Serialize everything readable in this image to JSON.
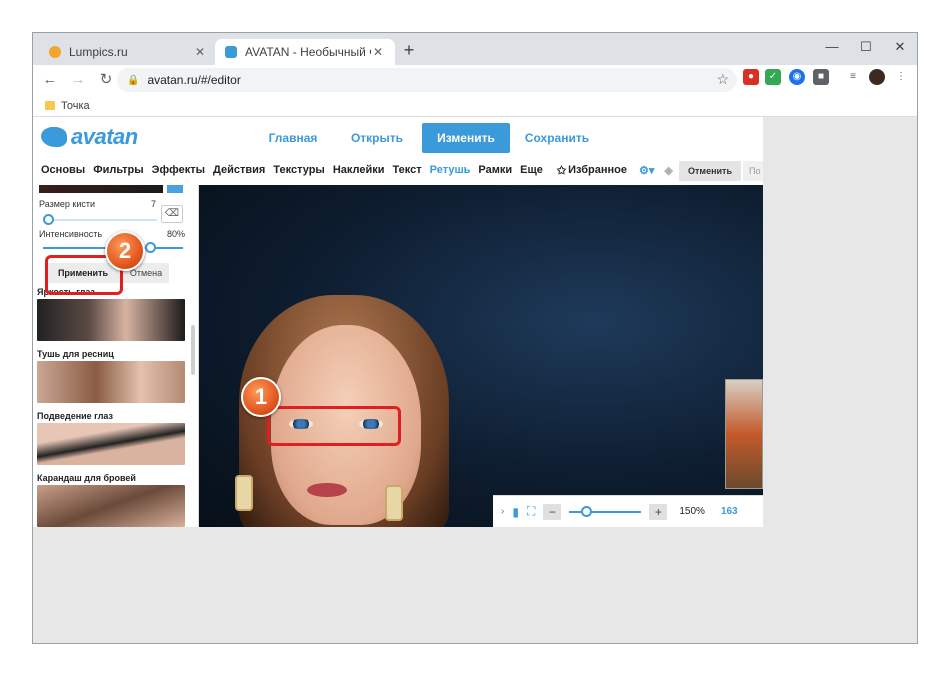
{
  "browser": {
    "tabs": [
      {
        "title": "Lumpics.ru",
        "favicon_color": "#f4a62a"
      },
      {
        "title": "AVATAN - Необычный Фоторед",
        "favicon_color": "#3b9ad9"
      }
    ],
    "new_tab_label": "+",
    "window_controls": {
      "minimize": "—",
      "maximize": "☐",
      "close": "✕"
    },
    "url": "avatan.ru/#/editor",
    "bookmark": "Точка"
  },
  "app": {
    "logo": "avatan",
    "brand_color": "#3b9ad9",
    "top_nav": [
      "Главная",
      "Открыть",
      "Изменить",
      "Сохранить"
    ],
    "active_top_nav": "Изменить",
    "menu": [
      "Основы",
      "Фильтры",
      "Эффекты",
      "Действия",
      "Текстуры",
      "Наклейки",
      "Текст",
      "Ретушь",
      "Рамки",
      "Еще",
      "Избранное"
    ],
    "active_menu": "Ретушь",
    "undo_label": "Отменить",
    "redo_label": "По"
  },
  "panel": {
    "brush_size_label": "Размер кисти",
    "brush_size_value": "7",
    "intensity_label": "Интенсивность",
    "intensity_value": "80%",
    "apply_label": "Применить",
    "cancel_label": "Отмена",
    "sections": [
      "Яркость глаз",
      "Тушь для ресниц",
      "Подведение глаз",
      "Карандаш для бровей"
    ]
  },
  "canvas": {
    "zoom": "150%",
    "coord": "163"
  },
  "annotations": {
    "step1": "1",
    "step2": "2"
  }
}
